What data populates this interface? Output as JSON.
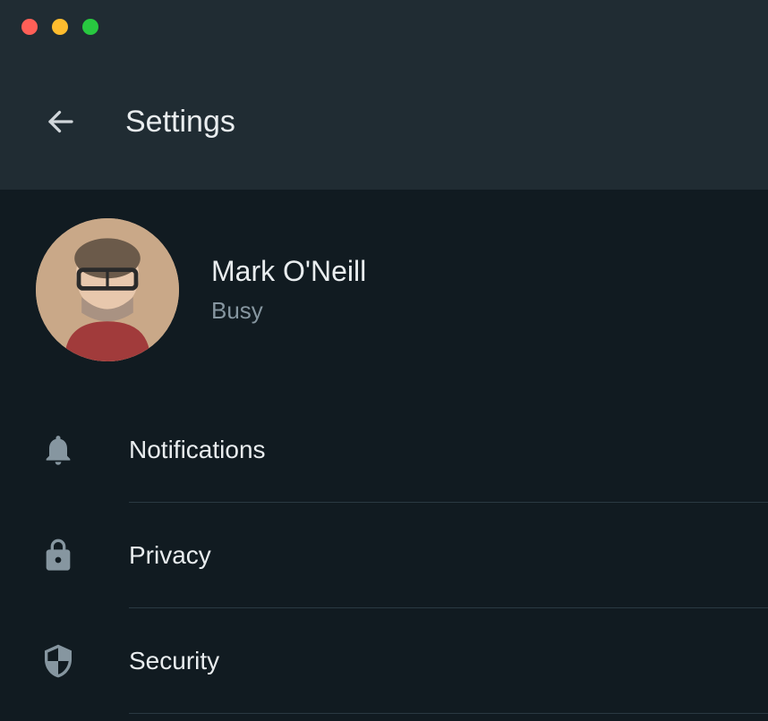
{
  "header": {
    "title": "Settings"
  },
  "profile": {
    "name": "Mark O'Neill",
    "status": "Busy"
  },
  "menu": {
    "items": [
      {
        "label": "Notifications",
        "icon": "bell-icon"
      },
      {
        "label": "Privacy",
        "icon": "lock-icon"
      },
      {
        "label": "Security",
        "icon": "shield-icon"
      }
    ]
  },
  "colors": {
    "bg": "#111b21",
    "header_bg": "#202c33",
    "text_primary": "#e9edef",
    "text_secondary": "#8696a0",
    "divider": "#2a3942"
  }
}
